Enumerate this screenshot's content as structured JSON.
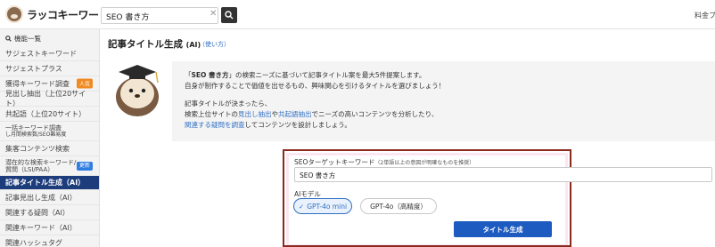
{
  "app": {
    "logo_text": "ラッコキーワード",
    "pricing_label": "料金プ"
  },
  "search": {
    "value": "SEO 書き方",
    "clear_icon": "close-icon",
    "button_icon": "search-icon"
  },
  "sidebar": {
    "header": "機能一覧",
    "items": [
      {
        "label": "サジェストキーワード"
      },
      {
        "label": "サジェストプラス"
      },
      {
        "label": "獲得キーワード調査",
        "badge": "人気"
      },
      {
        "label": "見出し抽出（上位20サイト）"
      },
      {
        "label": "共起語（上位20サイト）"
      },
      {
        "label": "一括キーワード調査",
        "sub": "し月間検索数/SEO難易度"
      },
      {
        "label": "集客コンテンツ検索"
      },
      {
        "label": "潜在的な検索キーワード/",
        "label2": "質問（LSI/PAA）",
        "badge": "更新"
      },
      {
        "label": "記事タイトル生成（AI）",
        "active": true
      },
      {
        "label": "記事見出し生成（AI）"
      },
      {
        "label": "関連する疑問（AI）"
      },
      {
        "label": "関連キーワード（AI）"
      },
      {
        "label": "関連ハッシュタグ"
      }
    ]
  },
  "main": {
    "title": "記事タイトル生成",
    "title_suffix": "(AI)",
    "help_link": "（使い方）",
    "intro": {
      "line1_pre": "「",
      "line1_kw": "SEO 書き方",
      "line1_post": "」の検索ニーズに基づいて記事タイトル案を最大5件提案します。",
      "line2": "自身が制作することで価値を出せるもの、興味関心を引けるタイトルを選びましょう！",
      "line3": "記事タイトルが決まったら、",
      "line4_pre": "検索上位サイトの",
      "line4_link1": "見出し抽出",
      "line4_mid": "や",
      "line4_link2": "共起語抽出",
      "line4_post": "でニーズの高いコンテンツを分析したり、",
      "line5_link": "関連する疑問を調査",
      "line5_post": "してコンテンツを設計しましょう。"
    },
    "form": {
      "keyword_label": "SEOターゲットキーワード",
      "keyword_note": "（2単語以上の意図が明確なものを推奨）",
      "keyword_value": "SEO 書き方",
      "model_label": "AIモデル",
      "models": [
        {
          "label": "GPT-4o mini",
          "selected": true
        },
        {
          "label": "GPT-4o（高精度）",
          "selected": false
        }
      ],
      "submit_label": "タイトル生成"
    }
  }
}
